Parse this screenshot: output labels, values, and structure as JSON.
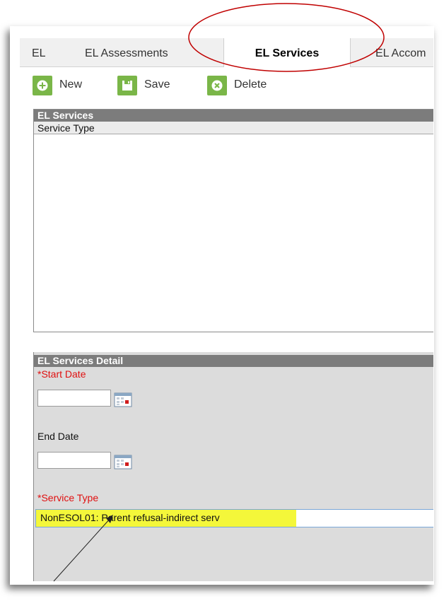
{
  "tabs": [
    {
      "label": "EL",
      "active": false
    },
    {
      "label": "EL Assessments",
      "active": false
    },
    {
      "label": "EL Services",
      "active": true
    },
    {
      "label": "EL Accom",
      "active": false
    }
  ],
  "toolbar": {
    "new_label": "New",
    "save_label": "Save",
    "delete_label": "Delete"
  },
  "services_grid": {
    "title": "EL Services",
    "columns": [
      "Service Type"
    ]
  },
  "detail": {
    "title": "EL Services Detail",
    "start_date_label": "*Start Date",
    "start_date_value": "",
    "end_date_label": "End Date",
    "end_date_value": "",
    "service_type_label": "*Service Type",
    "service_type_value": "NonESOL01: Parent refusal-indirect serv"
  },
  "colors": {
    "accent_green": "#7ab648",
    "required_red": "#e01010",
    "highlight_yellow": "#f4f73a",
    "annotation_red": "#c00000",
    "panel_header": "#7c7c7c"
  }
}
